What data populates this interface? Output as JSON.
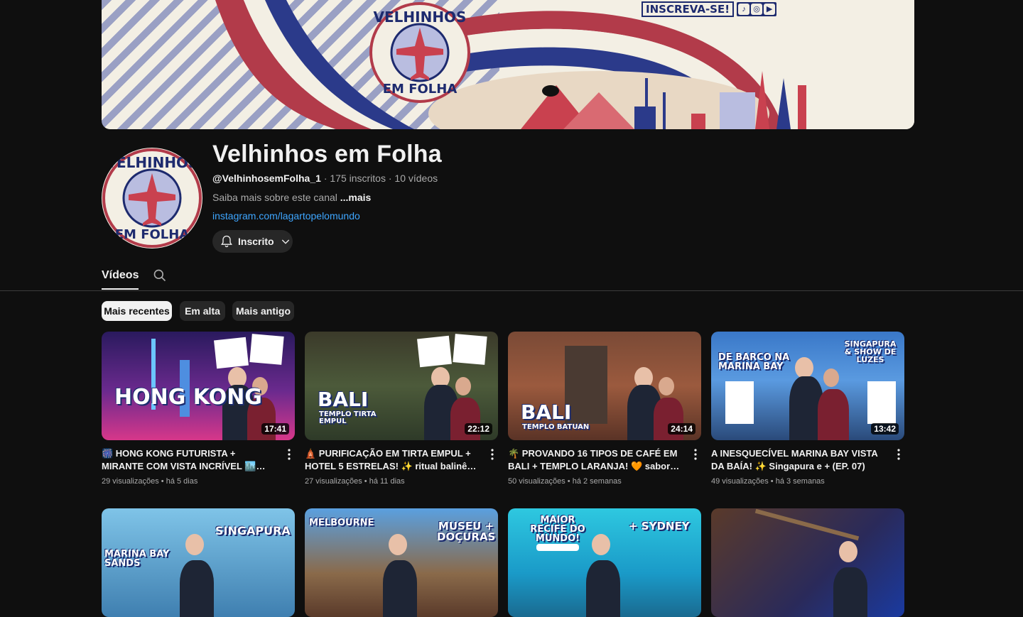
{
  "banner": {
    "cta_label": "INSCREVA-SE!",
    "social_icons": [
      "tiktok-icon",
      "instagram-icon",
      "youtube-icon"
    ],
    "logo_top": "VELHINHOS",
    "logo_bottom": "EM FOLHA"
  },
  "channel": {
    "name": "Velhinhos em Folha",
    "handle": "@VelhinhosemFolha_1",
    "subscribers": "175 inscritos",
    "videos_count": "10 vídeos",
    "about": "Saiba mais sobre este canal",
    "about_more": "...mais",
    "link": "instagram.com/lagartopelomundo",
    "subscribe_label": "Inscrito"
  },
  "tabs": {
    "videos": "Vídeos"
  },
  "chips": [
    {
      "label": "Mais recentes"
    },
    {
      "label": "Em alta"
    },
    {
      "label": "Mais antigo"
    }
  ],
  "videos": [
    {
      "title": "🎆 HONG KONG FUTURISTA + MIRANTE COM VISTA INCRÍVEL 🏙️ cidade moderna ...",
      "thumb_text": "HONG KONG",
      "duration": "17:41",
      "views": "29 visualizações",
      "age": "há 5 dias"
    },
    {
      "title": "🛕 PURIFICAÇÃO EM TIRTA EMPUL + HOTEL 5 ESTRELAS! ✨ ritual balinês e...",
      "thumb_text": "BALI",
      "thumb_sub": "TEMPLO TIRTA EMPUL",
      "duration": "22:12",
      "views": "27 visualizações",
      "age": "há 11 dias"
    },
    {
      "title": "🌴 PROVANDO 16 TIPOS DE CAFÉ EM BALI + TEMPLO LARANJA! 🧡 sabores intensos ...",
      "thumb_text": "BALI",
      "thumb_sub": "TEMPLO BATUAN",
      "duration": "24:14",
      "views": "50 visualizações",
      "age": "há 2 semanas"
    },
    {
      "title": "A INESQUECÍVEL MARINA BAY VISTA DA BAÍA! ✨ Singapura e + (EP. 07)",
      "thumb_text": "DE BARCO NA MARINA BAY",
      "thumb_sub": "SINGAPURA & SHOW DE LUZES",
      "duration": "13:42",
      "views": "49 visualizações",
      "age": "há 3 semanas"
    }
  ],
  "row2": [
    {
      "thumb_text": "SINGAPURA",
      "thumb_sub": "MARINA BAY SANDS"
    },
    {
      "thumb_text": "MELBOURNE",
      "thumb_sub": "MUSEU + DOÇURAS"
    },
    {
      "thumb_text": "MAIOR RECIFE DO MUNDO!",
      "thumb_sub": "+ SYDNEY"
    },
    {
      "thumb_text": ""
    }
  ]
}
